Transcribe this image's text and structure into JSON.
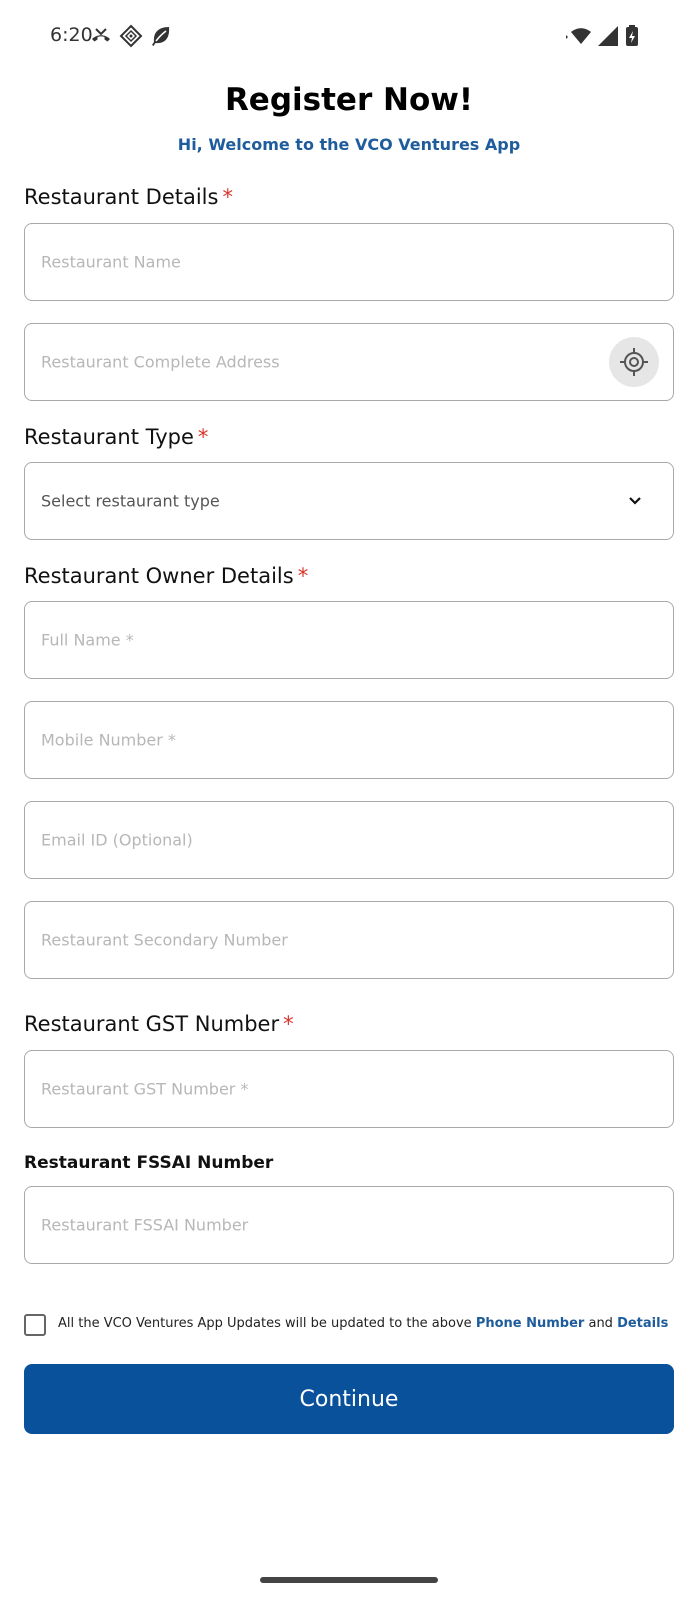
{
  "status_bar": {
    "time": "6:20",
    "left_icons": [
      "missed-call-icon",
      "diamond-app-icon",
      "leaf-icon"
    ],
    "right_icons": [
      "wifi-icon",
      "signal-icon",
      "battery-charging-icon"
    ]
  },
  "header": {
    "title": "Register Now!",
    "subtitle": "Hi, Welcome to the VCO Ventures App"
  },
  "sections": {
    "restaurant_details": {
      "label": "Restaurant Details",
      "required_mark": "*"
    },
    "restaurant_type": {
      "label": "Restaurant Type",
      "required_mark": "*"
    },
    "owner_details": {
      "label": "Restaurant Owner Details",
      "required_mark": "*"
    },
    "gst": {
      "label": "Restaurant GST Number",
      "required_mark": "*"
    },
    "fssai": {
      "label": "Restaurant FSSAI Number"
    }
  },
  "fields": {
    "restaurant_name": {
      "placeholder": "Restaurant Name",
      "value": ""
    },
    "restaurant_address": {
      "placeholder": "Restaurant Complete Address",
      "value": ""
    },
    "restaurant_type": {
      "selected": "Select restaurant type"
    },
    "full_name": {
      "placeholder": "Full Name *",
      "value": ""
    },
    "mobile_number": {
      "placeholder": "Mobile Number *",
      "value": ""
    },
    "email": {
      "placeholder": "Email ID (Optional)",
      "value": ""
    },
    "secondary_number": {
      "placeholder": "Restaurant Secondary Number",
      "value": ""
    },
    "gst_number": {
      "placeholder": "Restaurant GST Number *",
      "value": ""
    },
    "fssai_number": {
      "placeholder": "Restaurant FSSAI Number",
      "value": ""
    }
  },
  "consent": {
    "checked": false,
    "text_before": "All the VCO Ventures App Updates will be updated to the above ",
    "link_phone": "Phone Number",
    "text_and": " and ",
    "link_details": "Details"
  },
  "continue_button": {
    "label": "Continue"
  },
  "colors": {
    "accent": "#0a519c",
    "link": "#1f5c9c",
    "required": "#d9362b",
    "border": "#a9a9a9"
  }
}
